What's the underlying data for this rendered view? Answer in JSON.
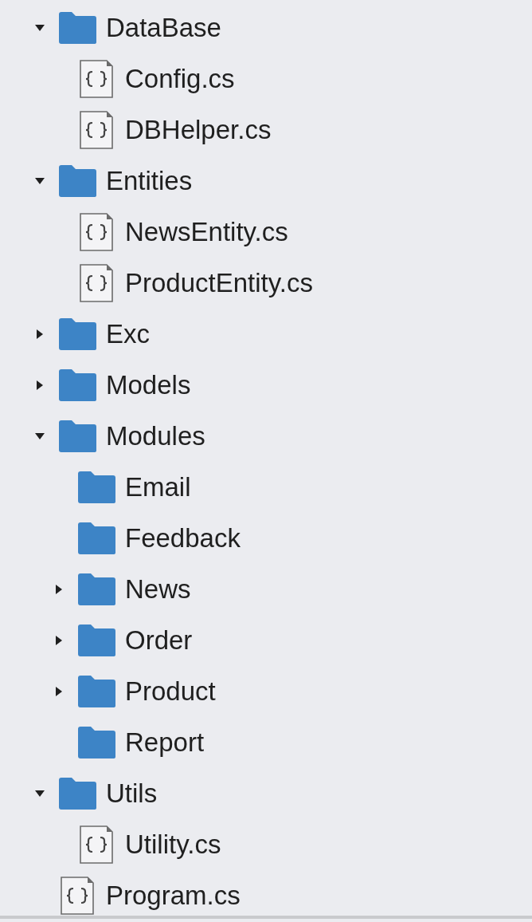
{
  "tree": [
    {
      "kind": "folder",
      "label": "DataBase",
      "expanded": true,
      "children": [
        {
          "kind": "file",
          "label": "Config.cs"
        },
        {
          "kind": "file",
          "label": "DBHelper.cs"
        }
      ]
    },
    {
      "kind": "folder",
      "label": "Entities",
      "expanded": true,
      "children": [
        {
          "kind": "file",
          "label": "NewsEntity.cs"
        },
        {
          "kind": "file",
          "label": "ProductEntity.cs"
        }
      ]
    },
    {
      "kind": "folder",
      "label": "Exc",
      "expanded": false
    },
    {
      "kind": "folder",
      "label": "Models",
      "expanded": false
    },
    {
      "kind": "folder",
      "label": "Modules",
      "expanded": true,
      "children": [
        {
          "kind": "folder",
          "label": "Email"
        },
        {
          "kind": "folder",
          "label": "Feedback"
        },
        {
          "kind": "folder",
          "label": "News",
          "expanded": false
        },
        {
          "kind": "folder",
          "label": "Order",
          "expanded": false
        },
        {
          "kind": "folder",
          "label": "Product",
          "expanded": false
        },
        {
          "kind": "folder",
          "label": "Report"
        }
      ]
    },
    {
      "kind": "folder",
      "label": "Utils",
      "expanded": true,
      "children": [
        {
          "kind": "file",
          "label": "Utility.cs"
        }
      ]
    },
    {
      "kind": "file",
      "label": "Program.cs"
    }
  ]
}
